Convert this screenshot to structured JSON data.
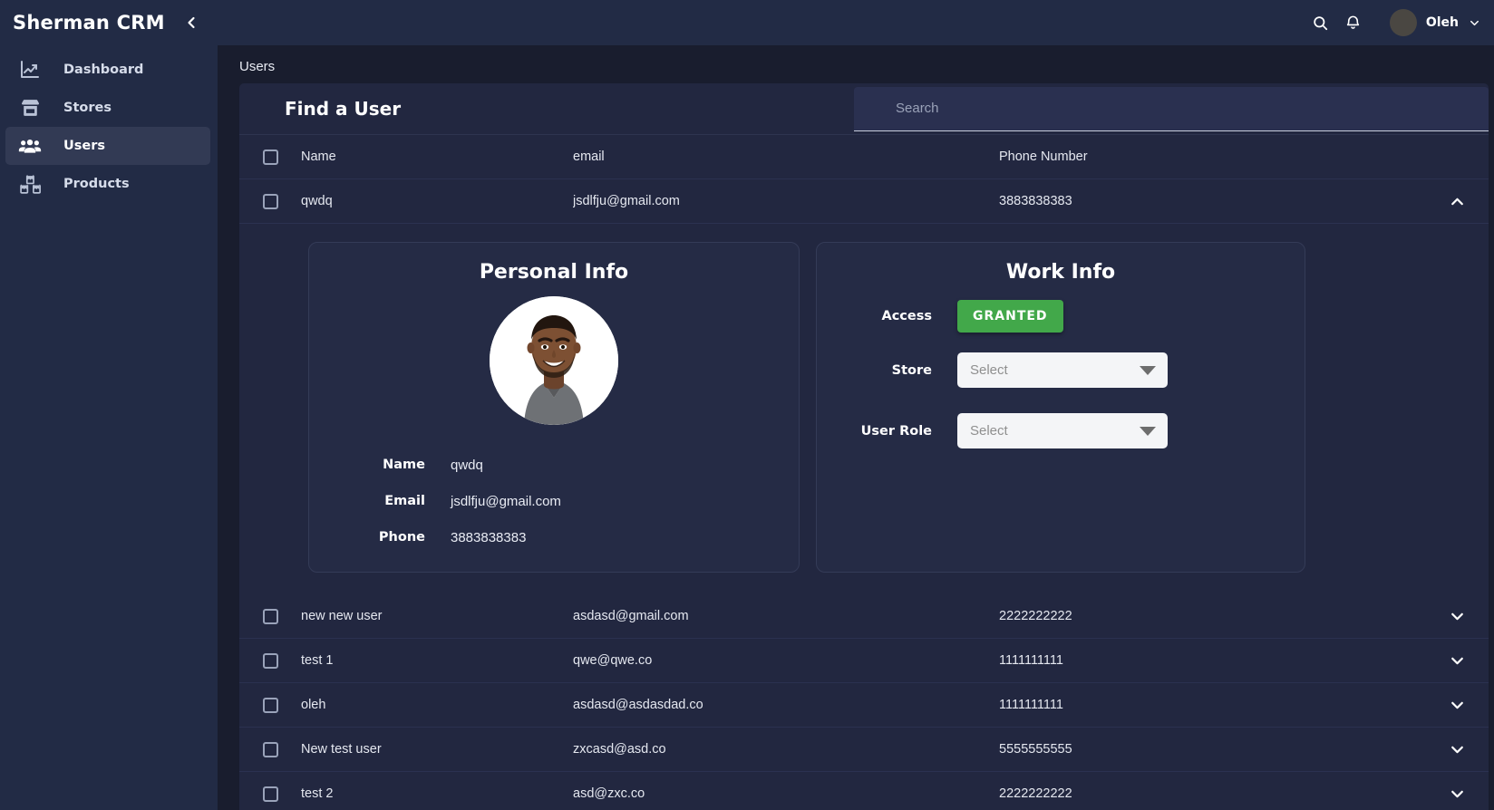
{
  "sidebar": {
    "brand": "Sherman CRM",
    "collapse_icon": "chevron-left-icon",
    "items": [
      {
        "label": "Dashboard",
        "icon": "chart-line-icon",
        "active": false
      },
      {
        "label": "Stores",
        "icon": "store-icon",
        "active": false
      },
      {
        "label": "Users",
        "icon": "users-icon",
        "active": true
      },
      {
        "label": "Products",
        "icon": "boxes-icon",
        "active": false
      }
    ]
  },
  "topbar": {
    "search_icon": "search-icon",
    "bell_icon": "bell-icon",
    "user_name": "Oleh",
    "caret_icon": "chevron-down-icon"
  },
  "breadcrumb": "Users",
  "card": {
    "title": "Find a User",
    "search_placeholder": "Search",
    "search_value": ""
  },
  "table": {
    "columns": [
      "Name",
      "email",
      "Phone Number"
    ],
    "rows": [
      {
        "name": "qwdq",
        "email": "jsdlfju@gmail.com",
        "phone": "3883838383",
        "expanded": true
      },
      {
        "name": "new new user",
        "email": "asdasd@gmail.com",
        "phone": "2222222222",
        "expanded": false
      },
      {
        "name": "test 1",
        "email": "qwe@qwe.co",
        "phone": "1111111111",
        "expanded": false
      },
      {
        "name": "oleh",
        "email": "asdasd@asdasdad.co",
        "phone": "1111111111",
        "expanded": false
      },
      {
        "name": "New test user",
        "email": "zxcasd@asd.co",
        "phone": "5555555555",
        "expanded": false
      },
      {
        "name": "test 2",
        "email": "asd@zxc.co",
        "phone": "2222222222",
        "expanded": false
      }
    ]
  },
  "detail": {
    "personal": {
      "title": "Personal Info",
      "avatar_alt": "user-photo",
      "fields": [
        {
          "label": "Name",
          "value": "qwdq"
        },
        {
          "label": "Email",
          "value": "jsdlfju@gmail.com"
        },
        {
          "label": "Phone",
          "value": "3883838383"
        }
      ]
    },
    "work": {
      "title": "Work Info",
      "access_label": "Access",
      "access_value": "GRANTED",
      "access_color": "#42a84a",
      "store_label": "Store",
      "store_value": "Select",
      "role_label": "User Role",
      "role_value": "Select"
    }
  },
  "colors": {
    "sidebar_bg": "#222b45",
    "page_bg": "#191d2e",
    "card_bg": "#222740",
    "panel_bg": "#252b45",
    "accent_green": "#42a84a",
    "active_nav": "#323a54"
  }
}
